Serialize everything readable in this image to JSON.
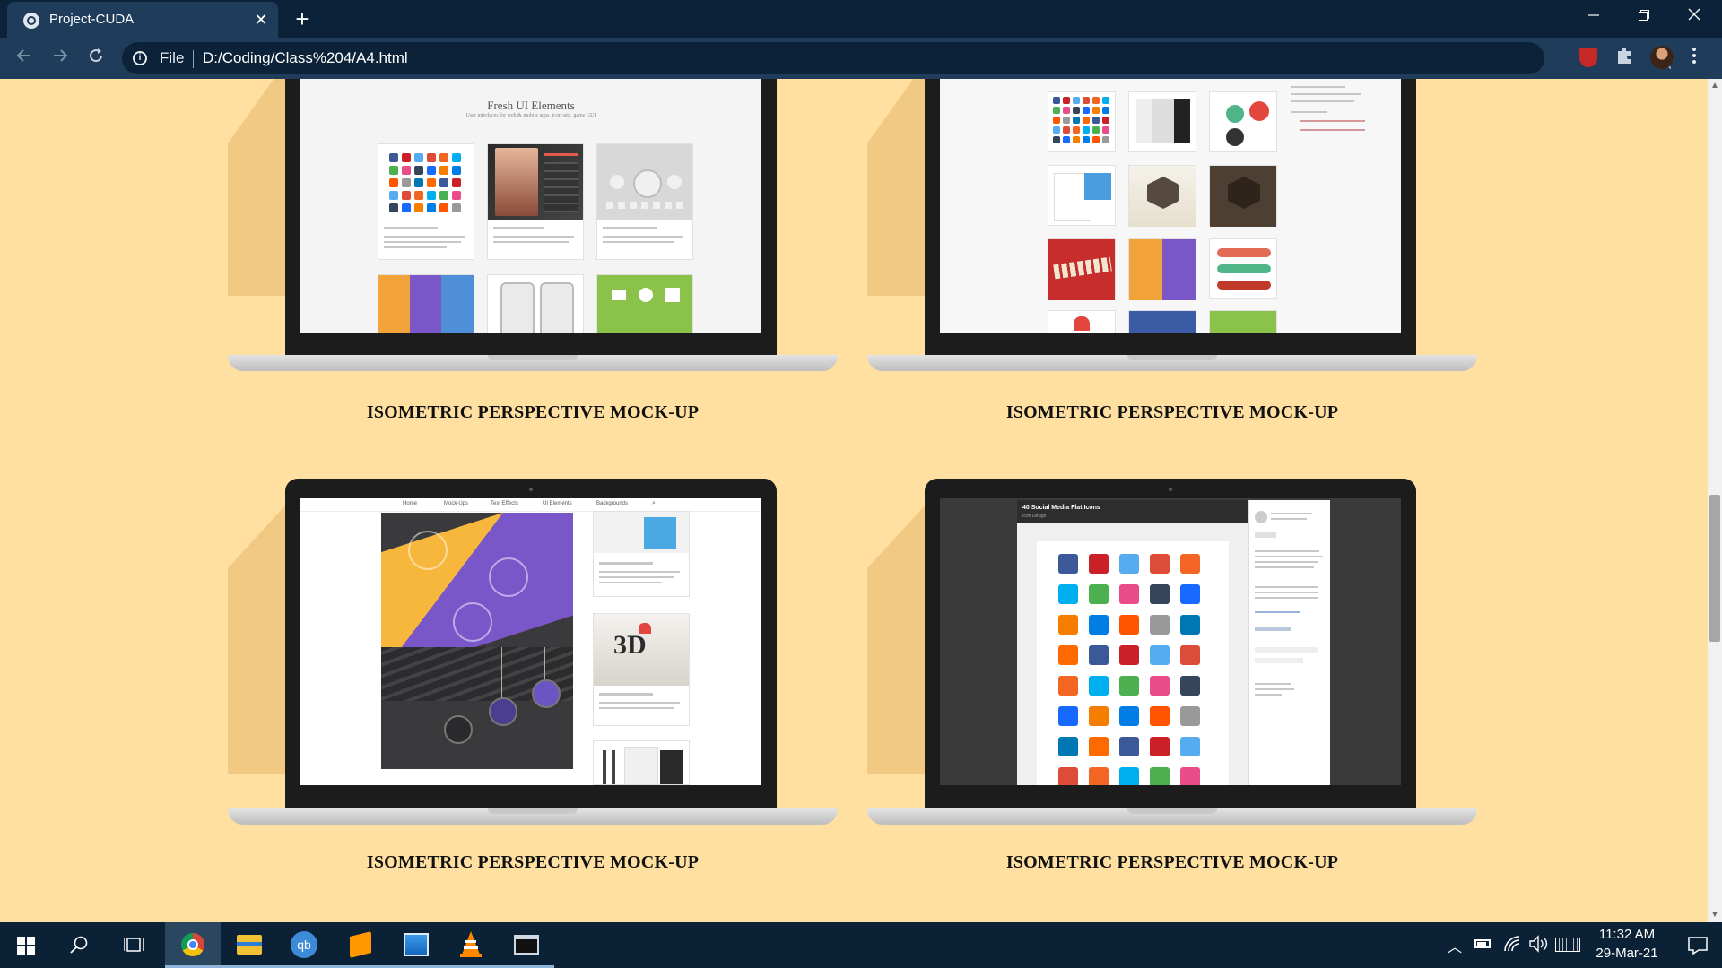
{
  "browser": {
    "tab_title": "Project-CUDA",
    "scheme_label": "File",
    "url": "D:/Coding/Class%204/A4.html",
    "new_tab_symbol": "+",
    "close_symbol": "✕"
  },
  "cards": [
    {
      "caption": "ISOMETRIC PERSPECTIVE MOCK-UP",
      "screen_title": "Fresh UI Elements",
      "screen_subtitle": "User interfaces for web & mobile apps, icon sets, game GUI"
    },
    {
      "caption": "ISOMETRIC PERSPECTIVE MOCK-UP"
    },
    {
      "caption": "ISOMETRIC PERSPECTIVE MOCK-UP",
      "nav": [
        "Home",
        "Mock-Ups",
        "Text Effects",
        "UI Elements",
        "Backgrounds"
      ]
    },
    {
      "caption": "ISOMETRIC PERSPECTIVE MOCK-UP",
      "screen_title": "40 Social Media Flat Icons",
      "screen_subtitle": "Icon Design"
    }
  ],
  "taskbar": {
    "time": "11:32 AM",
    "date": "29-Mar-21",
    "apps": [
      "chrome",
      "file-explorer",
      "qbittorrent",
      "sublime-text",
      "photos",
      "vlc",
      "terminal"
    ]
  },
  "colors": {
    "page_bg": "#ffe0a1",
    "tabbar_bg": "#0c2238",
    "toolbar_bg": "#1f3c5a",
    "taskbar_bg": "#0b2236"
  }
}
